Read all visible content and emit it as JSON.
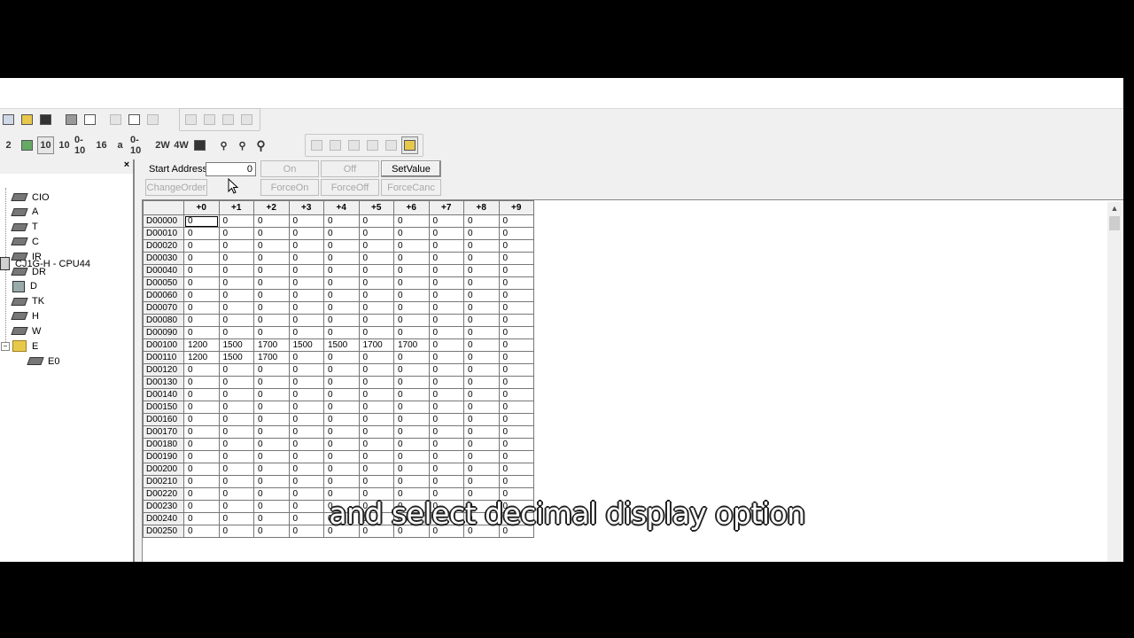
{
  "tree": {
    "root": "CJ1G-H - CPU44",
    "items": [
      "CIO",
      "A",
      "T",
      "C",
      "IR",
      "DR",
      "D",
      "TK",
      "H",
      "W"
    ],
    "folder": "E",
    "folder_child": "E0"
  },
  "controls": {
    "start_address_label": "Start Address:",
    "start_address_value": "0",
    "on": "On",
    "off": "Off",
    "set_value": "SetValue",
    "change_order": "ChangeOrder",
    "force_on": "ForceOn",
    "force_off": "ForceOff",
    "force_cancel": "ForceCanc"
  },
  "toolbar": {
    "row2_text": [
      "2",
      "10",
      "10",
      "0-10",
      "16",
      "a",
      "0-10",
      "2W",
      "4W"
    ]
  },
  "grid": {
    "columns": [
      "+0",
      "+1",
      "+2",
      "+3",
      "+4",
      "+5",
      "+6",
      "+7",
      "+8",
      "+9"
    ],
    "rows": [
      {
        "addr": "D00000",
        "vals": [
          "0",
          "0",
          "0",
          "0",
          "0",
          "0",
          "0",
          "0",
          "0",
          "0"
        ]
      },
      {
        "addr": "D00010",
        "vals": [
          "0",
          "0",
          "0",
          "0",
          "0",
          "0",
          "0",
          "0",
          "0",
          "0"
        ]
      },
      {
        "addr": "D00020",
        "vals": [
          "0",
          "0",
          "0",
          "0",
          "0",
          "0",
          "0",
          "0",
          "0",
          "0"
        ]
      },
      {
        "addr": "D00030",
        "vals": [
          "0",
          "0",
          "0",
          "0",
          "0",
          "0",
          "0",
          "0",
          "0",
          "0"
        ]
      },
      {
        "addr": "D00040",
        "vals": [
          "0",
          "0",
          "0",
          "0",
          "0",
          "0",
          "0",
          "0",
          "0",
          "0"
        ]
      },
      {
        "addr": "D00050",
        "vals": [
          "0",
          "0",
          "0",
          "0",
          "0",
          "0",
          "0",
          "0",
          "0",
          "0"
        ]
      },
      {
        "addr": "D00060",
        "vals": [
          "0",
          "0",
          "0",
          "0",
          "0",
          "0",
          "0",
          "0",
          "0",
          "0"
        ]
      },
      {
        "addr": "D00070",
        "vals": [
          "0",
          "0",
          "0",
          "0",
          "0",
          "0",
          "0",
          "0",
          "0",
          "0"
        ]
      },
      {
        "addr": "D00080",
        "vals": [
          "0",
          "0",
          "0",
          "0",
          "0",
          "0",
          "0",
          "0",
          "0",
          "0"
        ]
      },
      {
        "addr": "D00090",
        "vals": [
          "0",
          "0",
          "0",
          "0",
          "0",
          "0",
          "0",
          "0",
          "0",
          "0"
        ]
      },
      {
        "addr": "D00100",
        "vals": [
          "1200",
          "1500",
          "1700",
          "1500",
          "1500",
          "1700",
          "1700",
          "0",
          "0",
          "0"
        ]
      },
      {
        "addr": "D00110",
        "vals": [
          "1200",
          "1500",
          "1700",
          "0",
          "0",
          "0",
          "0",
          "0",
          "0",
          "0"
        ]
      },
      {
        "addr": "D00120",
        "vals": [
          "0",
          "0",
          "0",
          "0",
          "0",
          "0",
          "0",
          "0",
          "0",
          "0"
        ]
      },
      {
        "addr": "D00130",
        "vals": [
          "0",
          "0",
          "0",
          "0",
          "0",
          "0",
          "0",
          "0",
          "0",
          "0"
        ]
      },
      {
        "addr": "D00140",
        "vals": [
          "0",
          "0",
          "0",
          "0",
          "0",
          "0",
          "0",
          "0",
          "0",
          "0"
        ]
      },
      {
        "addr": "D00150",
        "vals": [
          "0",
          "0",
          "0",
          "0",
          "0",
          "0",
          "0",
          "0",
          "0",
          "0"
        ]
      },
      {
        "addr": "D00160",
        "vals": [
          "0",
          "0",
          "0",
          "0",
          "0",
          "0",
          "0",
          "0",
          "0",
          "0"
        ]
      },
      {
        "addr": "D00170",
        "vals": [
          "0",
          "0",
          "0",
          "0",
          "0",
          "0",
          "0",
          "0",
          "0",
          "0"
        ]
      },
      {
        "addr": "D00180",
        "vals": [
          "0",
          "0",
          "0",
          "0",
          "0",
          "0",
          "0",
          "0",
          "0",
          "0"
        ]
      },
      {
        "addr": "D00190",
        "vals": [
          "0",
          "0",
          "0",
          "0",
          "0",
          "0",
          "0",
          "0",
          "0",
          "0"
        ]
      },
      {
        "addr": "D00200",
        "vals": [
          "0",
          "0",
          "0",
          "0",
          "0",
          "0",
          "0",
          "0",
          "0",
          "0"
        ]
      },
      {
        "addr": "D00210",
        "vals": [
          "0",
          "0",
          "0",
          "0",
          "0",
          "0",
          "0",
          "0",
          "0",
          "0"
        ]
      },
      {
        "addr": "D00220",
        "vals": [
          "0",
          "0",
          "0",
          "0",
          "0",
          "0",
          "0",
          "0",
          "0",
          "0"
        ]
      },
      {
        "addr": "D00230",
        "vals": [
          "0",
          "0",
          "0",
          "0",
          "0",
          "0",
          "0",
          "0",
          "0",
          "0"
        ]
      },
      {
        "addr": "D00240",
        "vals": [
          "0",
          "0",
          "0",
          "0",
          "0",
          "0",
          "0",
          "0",
          "0",
          "0"
        ]
      },
      {
        "addr": "D00250",
        "vals": [
          "0",
          "0",
          "0",
          "0",
          "0",
          "0",
          "0",
          "0",
          "0",
          "0"
        ]
      }
    ]
  },
  "caption": "and select decimal display option"
}
